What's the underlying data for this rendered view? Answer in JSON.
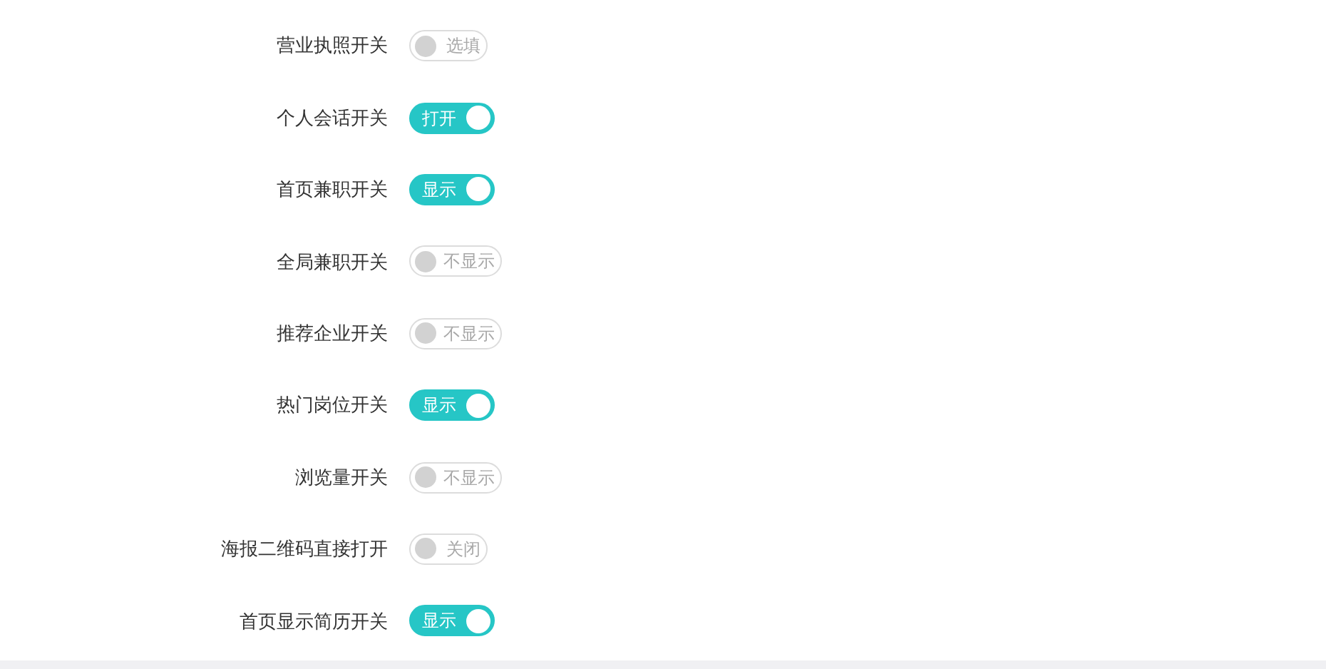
{
  "settings": [
    {
      "label": "营业执照开关",
      "on": false,
      "text": "选填"
    },
    {
      "label": "个人会话开关",
      "on": true,
      "text": "打开"
    },
    {
      "label": "首页兼职开关",
      "on": true,
      "text": "显示"
    },
    {
      "label": "全局兼职开关",
      "on": false,
      "text": "不显示"
    },
    {
      "label": "推荐企业开关",
      "on": false,
      "text": "不显示"
    },
    {
      "label": "热门岗位开关",
      "on": true,
      "text": "显示"
    },
    {
      "label": "浏览量开关",
      "on": false,
      "text": "不显示"
    },
    {
      "label": "海报二维码直接打开",
      "on": false,
      "text": "关闭"
    },
    {
      "label": "首页显示简历开关",
      "on": true,
      "text": "显示"
    }
  ]
}
